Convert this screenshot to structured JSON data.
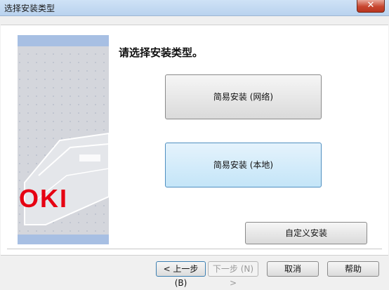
{
  "window": {
    "title": "选择安装类型",
    "close_label": "✕"
  },
  "panel": {
    "heading": "请选择安装类型。",
    "brand_logo_text": "OKI"
  },
  "options": {
    "network_install": "简易安装 (网络)",
    "local_install": "简易安装 (本地)",
    "custom_install": "自定义安装"
  },
  "footer": {
    "back": "< 上一步 (B)",
    "next": "下一步 (N) >",
    "cancel": "取消",
    "help": "帮助"
  },
  "colors": {
    "logo_red": "#e60012",
    "side_blue": "#a7bfe3",
    "side_gray": "#d4d6dc"
  }
}
